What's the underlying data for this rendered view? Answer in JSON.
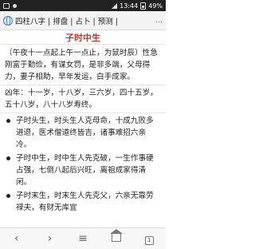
{
  "status_bar": {
    "time": "13:44",
    "battery": "49%"
  },
  "url_bar": {
    "text": "四柱八字 | 排盘 | 占卜 | 预测 | ",
    "more": "…"
  },
  "article": {
    "title": "子时中生",
    "intro": "（午夜十一点起上午一点止，为鼠时辰）性急刚富于勤俭，有谋女罚，是非多端，父母得力，妻子相助，早年发运，白手成家。",
    "lifespan": "凶年：十一岁，十八岁，三六岁，四十五岁，五十八岁，八十八岁寿终。",
    "bullets": [
      "子时头生，时头生人克母命，十成九败多进退，医术僧道终皆吉，诸事难招六亲冷。",
      "子时中生，时中生人先克破，一生作事硬占强，七倒八起后兴旺，离祖成家得清闲。",
      "子时末生，时末生人先克父，六亲无靠劳禄夫，有财无库宜"
    ]
  },
  "nav": {
    "back": "‹",
    "forward": "›",
    "menu": "≡",
    "tab_count": "1"
  }
}
